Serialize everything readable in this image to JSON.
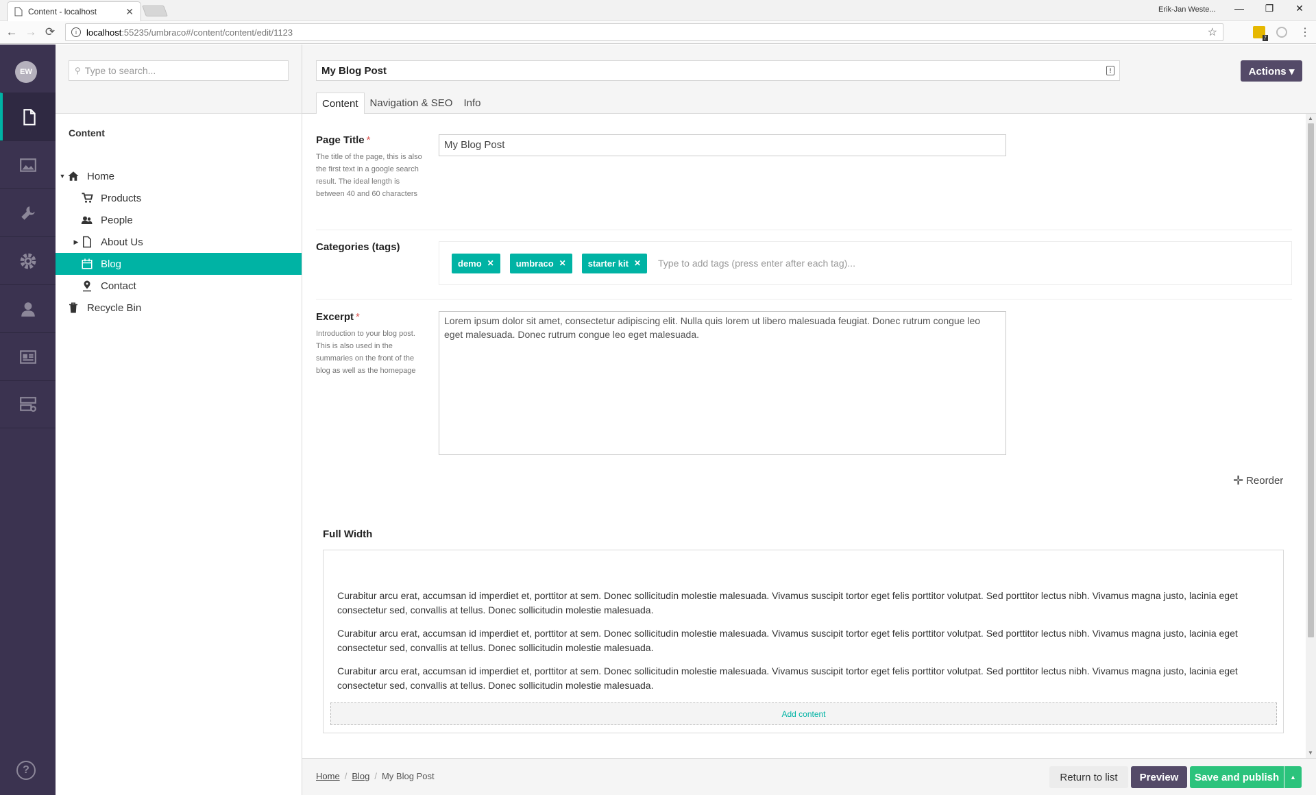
{
  "browser": {
    "tab_title": "Content - localhost",
    "tab_close": "✕",
    "profile_name": "Erik-Jan Weste...",
    "window_controls": {
      "minimize": "—",
      "maximize": "❐",
      "close": "✕"
    },
    "url_host": "localhost",
    "url_path": ":55235/umbraco#/content/content/edit/1123",
    "nav": {
      "back": "←",
      "forward": "→",
      "reload": "⟳"
    },
    "ext_badge": "7"
  },
  "user": {
    "initials": "EW"
  },
  "appbar": {
    "sections": [
      {
        "name": "content",
        "icon": "document-icon",
        "active": true
      },
      {
        "name": "media",
        "icon": "image-icon",
        "active": false
      },
      {
        "name": "settings",
        "icon": "wrench-icon",
        "active": false
      },
      {
        "name": "developer",
        "icon": "gear-icon",
        "active": false
      },
      {
        "name": "users",
        "icon": "user-icon",
        "active": false
      },
      {
        "name": "members",
        "icon": "id-card-icon",
        "active": false
      },
      {
        "name": "forms",
        "icon": "forms-icon",
        "active": false
      }
    ],
    "help": "?"
  },
  "tree": {
    "search_placeholder": "Type to search...",
    "heading": "Content",
    "items": [
      {
        "label": "Home",
        "icon": "home-icon",
        "expanded": true
      },
      {
        "label": "Products",
        "icon": "cart-icon"
      },
      {
        "label": "People",
        "icon": "people-icon"
      },
      {
        "label": "About Us",
        "icon": "document-icon",
        "collapsed": true
      },
      {
        "label": "Blog",
        "icon": "calendar-icon",
        "selected": true
      },
      {
        "label": "Contact",
        "icon": "map-pin-icon"
      },
      {
        "label": "Recycle Bin",
        "icon": "trash-icon"
      }
    ]
  },
  "editor": {
    "name": "My Blog Post",
    "actions_label": "Actions ▾",
    "tabs": [
      {
        "label": "Content",
        "active": true
      },
      {
        "label": "Navigation & SEO",
        "active": false
      },
      {
        "label": "Info",
        "active": false
      }
    ],
    "page_title": {
      "label": "Page Title",
      "required": "*",
      "description": "The title of the page, this is also the first text in a google search result. The ideal length is between 40 and 60 characters",
      "value": "My Blog Post"
    },
    "categories": {
      "label": "Categories (tags)",
      "tags": [
        "demo",
        "umbraco",
        "starter kit"
      ],
      "tag_remove": "✕",
      "placeholder": "Type to add tags (press enter after each tag)..."
    },
    "excerpt": {
      "label": "Excerpt",
      "required": "*",
      "description": "Introduction to your blog post. This is also used in the summaries on the front of the blog as well as the homepage",
      "value": "Lorem ipsum dolor sit amet, consectetur adipiscing elit. Nulla quis lorem ut libero malesuada feugiat. Donec rutrum congue leo eget malesuada. Donec rutrum congue leo eget malesuada."
    },
    "reorder_label": "Reorder",
    "grid": {
      "title": "Full Width",
      "paragraphs": [
        "Curabitur arcu erat, accumsan id imperdiet et, porttitor at sem. Donec sollicitudin molestie malesuada. Vivamus suscipit tortor eget felis porttitor volutpat. Sed porttitor lectus nibh. Vivamus magna justo, lacinia eget consectetur sed, convallis at tellus. Donec sollicitudin molestie malesuada.",
        "Curabitur arcu erat, accumsan id imperdiet et, porttitor at sem. Donec sollicitudin molestie malesuada. Vivamus suscipit tortor eget felis porttitor volutpat. Sed porttitor lectus nibh. Vivamus magna justo, lacinia eget consectetur sed, convallis at tellus. Donec sollicitudin molestie malesuada.",
        "Curabitur arcu erat, accumsan id imperdiet et, porttitor at sem. Donec sollicitudin molestie malesuada. Vivamus suscipit tortor eget felis porttitor volutpat. Sed porttitor lectus nibh. Vivamus magna justo, lacinia eget consectetur sed, convallis at tellus. Donec sollicitudin molestie malesuada."
      ],
      "add_content": "Add content"
    }
  },
  "footer": {
    "breadcrumb": [
      "Home",
      "Blog",
      "My Blog Post"
    ],
    "separator": "/",
    "return_label": "Return to list",
    "preview_label": "Preview",
    "save_label": "Save and publish",
    "caret": "▲"
  },
  "colors": {
    "accent": "#00b3a4",
    "appbar": "#3b3350",
    "primary_button": "#544a68",
    "success": "#2bc37c"
  }
}
